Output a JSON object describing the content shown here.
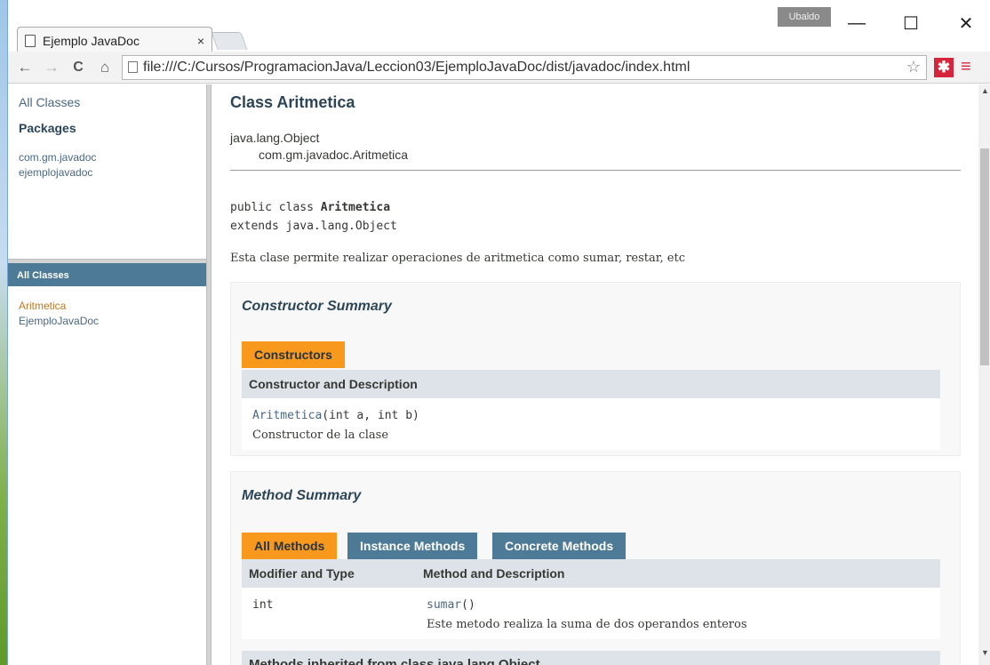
{
  "browser": {
    "tab_title": "Ejemplo JavaDoc",
    "tab_close": "×",
    "user_badge": "Ubaldo",
    "window_controls": {
      "minimize": "—",
      "maximize": "☐",
      "close": "✕"
    },
    "nav": {
      "back": "←",
      "forward": "→",
      "reload": "C",
      "home": "⌂"
    },
    "url": "file:///C:/Cursos/ProgramacionJava/Leccion03/EjemploJavaDoc/dist/javadoc/index.html",
    "star": "☆",
    "extension_glyph": "✱",
    "menu_glyph": "≡"
  },
  "packages_frame": {
    "all_classes_link": "All Classes",
    "heading": "Packages",
    "packages": [
      "com.gm.javadoc",
      "ejemplojavadoc"
    ]
  },
  "classes_frame": {
    "bar_title": "All Classes",
    "classes": [
      "Aritmetica",
      "EjemploJavaDoc"
    ]
  },
  "main": {
    "class_title": "Class Aritmetica",
    "inheritance": [
      "java.lang.Object",
      "com.gm.javadoc.Aritmetica"
    ],
    "signature": {
      "prefix": "public class ",
      "name": "Aritmetica",
      "extends_line": "extends java.lang.Object"
    },
    "description": "Esta clase permite realizar operaciones de aritmetica como sumar, restar, etc",
    "constructor_summary": {
      "heading": "Constructor Summary",
      "tab": "Constructors",
      "column": "Constructor and Description",
      "rows": [
        {
          "name": "Aritmetica",
          "params": "(int a, int b)",
          "description": "Constructor de la clase"
        }
      ]
    },
    "method_summary": {
      "heading": "Method Summary",
      "tabs": [
        "All Methods",
        "Instance Methods",
        "Concrete Methods"
      ],
      "columns": [
        "Modifier and Type",
        "Method and Description"
      ],
      "rows": [
        {
          "type": "int",
          "name": "sumar",
          "params": "()",
          "description": "Este metodo realiza la suma de dos operandos enteros"
        }
      ]
    },
    "inherited_heading": "Methods inherited from class java.lang.Object"
  }
}
